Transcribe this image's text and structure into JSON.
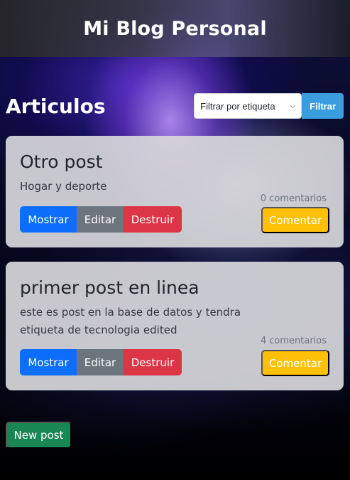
{
  "header": {
    "title": "Mi Blog Personal"
  },
  "main": {
    "heading": "Articulos",
    "filter": {
      "selected": "Filtrar por etiqueta",
      "button_label": "Filtrar"
    },
    "posts": [
      {
        "title": "Otro post",
        "description": "Hogar y deporte",
        "comments": "0 comentarios",
        "show_label": "Mostrar",
        "edit_label": "Editar",
        "destroy_label": "Destruir",
        "comment_label": "Comentar"
      },
      {
        "title": "primer post en linea",
        "description": "este es post en la base de datos y tendra etiqueta de tecnologia edited",
        "comments": "4 comentarios",
        "show_label": "Mostrar",
        "edit_label": "Editar",
        "destroy_label": "Destruir",
        "comment_label": "Comentar"
      }
    ],
    "new_post_label": "New post"
  },
  "colors": {
    "primary": "#0d6efd",
    "secondary": "#6c757d",
    "danger": "#dc3545",
    "warning": "#ffc107",
    "success": "#198754",
    "filter": "#3b9ddd"
  }
}
